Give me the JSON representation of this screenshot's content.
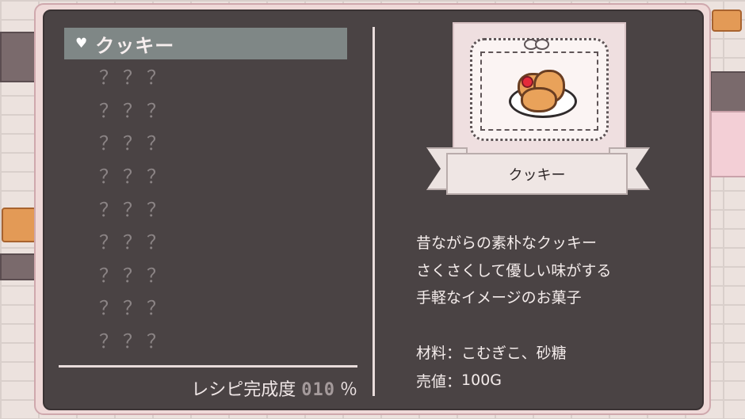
{
  "recipe_list": {
    "items": [
      {
        "label": "クッキー",
        "selected": true
      },
      {
        "label": "？？？"
      },
      {
        "label": "？？？"
      },
      {
        "label": "？？？"
      },
      {
        "label": "？？？"
      },
      {
        "label": "？？？"
      },
      {
        "label": "？？？"
      },
      {
        "label": "？？？"
      },
      {
        "label": "？？？"
      },
      {
        "label": "？？？"
      }
    ],
    "selected_icon": "heart-icon"
  },
  "completion": {
    "label": "レシピ完成度",
    "value": "010",
    "unit": "％"
  },
  "detail": {
    "name": "クッキー",
    "image_icon": "cookie-plate-icon",
    "description": [
      "昔ながらの素朴なクッキー",
      "さくさくして優しい味がする",
      "手軽なイメージのお菓子"
    ],
    "ingredients_label": "材料：",
    "ingredients_value": "こむぎこ、砂糖",
    "price_label": "売値：",
    "price_value": "100G"
  },
  "colors": {
    "panel": "#4a4344",
    "selected_row": "#7f8786",
    "frame": "#efd9d8"
  }
}
